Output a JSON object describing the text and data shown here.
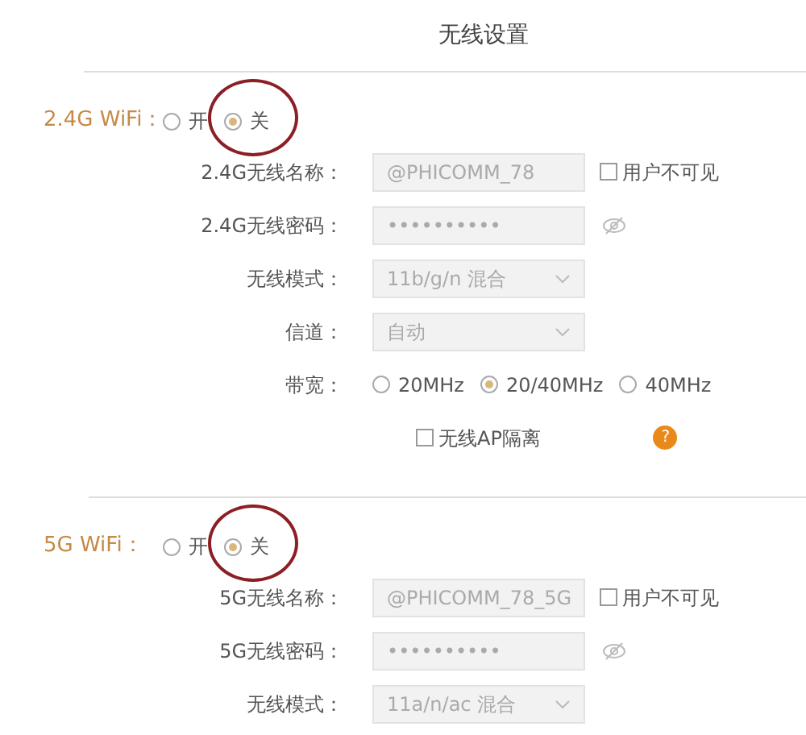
{
  "title": "无线设置",
  "sections": [
    {
      "label": "2.4G WiFi：",
      "options": [
        {
          "label": "开",
          "selected": false,
          "circled": false
        },
        {
          "label": "关",
          "selected": true,
          "circled": true
        }
      ],
      "rows": [
        {
          "kind": "text",
          "label": "2.4G无线名称：",
          "value": "@PHICOMM_78",
          "checkbox": {
            "label": "用户不可见",
            "checked": false
          }
        },
        {
          "kind": "password",
          "label": "2.4G无线密码：",
          "value": "••••••••••"
        },
        {
          "kind": "select",
          "label": "无线模式：",
          "value": "11b/g/n 混合"
        },
        {
          "kind": "select",
          "label": "信道：",
          "value": "自动"
        },
        {
          "kind": "radios",
          "label": "带宽：",
          "options": [
            {
              "label": "20MHz",
              "selected": false
            },
            {
              "label": "20/40MHz",
              "selected": true
            },
            {
              "label": "40MHz",
              "selected": false
            }
          ]
        },
        {
          "kind": "checkbox",
          "label": "无线AP隔离",
          "checked": false,
          "help": "?"
        }
      ]
    },
    {
      "label": "5G WiFi：",
      "options": [
        {
          "label": "开",
          "selected": false,
          "circled": false
        },
        {
          "label": "关",
          "selected": true,
          "circled": true
        }
      ],
      "rows": [
        {
          "kind": "text",
          "label": "5G无线名称：",
          "value": "@PHICOMM_78_5G",
          "checkbox": {
            "label": "用户不可见",
            "checked": false
          }
        },
        {
          "kind": "password",
          "label": "5G无线密码：",
          "value": "••••••••••"
        },
        {
          "kind": "select",
          "label": "无线模式：",
          "value": "11a/n/ac 混合"
        }
      ]
    }
  ]
}
